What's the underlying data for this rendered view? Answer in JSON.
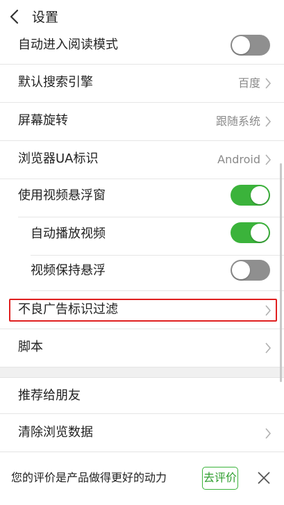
{
  "header": {
    "title": "设置"
  },
  "rows": [
    {
      "label": "自动进入阅读模式",
      "toggle": "off"
    },
    {
      "label": "默认搜索引擎",
      "value": "百度"
    },
    {
      "label": "屏幕旋转",
      "value": "跟随系统"
    },
    {
      "label": "浏览器UA标识",
      "value": "Android"
    },
    {
      "label": "使用视频悬浮窗",
      "toggle": "on"
    },
    {
      "label": "自动播放视频",
      "toggle": "on"
    },
    {
      "label": "视频保持悬浮",
      "toggle": "off"
    },
    {
      "label": "不良广告标识过滤"
    },
    {
      "label": "脚本"
    },
    {
      "label": "推荐给朋友"
    },
    {
      "label": "清除浏览数据"
    }
  ],
  "footer": {
    "text": "您的评价是产品做得更好的动力",
    "rate_label": "去评价"
  },
  "colors": {
    "accent": "#3bb33b",
    "highlight": "#e02020",
    "toggle_off": "#8f8f8f"
  },
  "icons": {
    "back": "chevron-left-icon",
    "row_arrow": "chevron-right-icon",
    "close": "close-icon"
  }
}
